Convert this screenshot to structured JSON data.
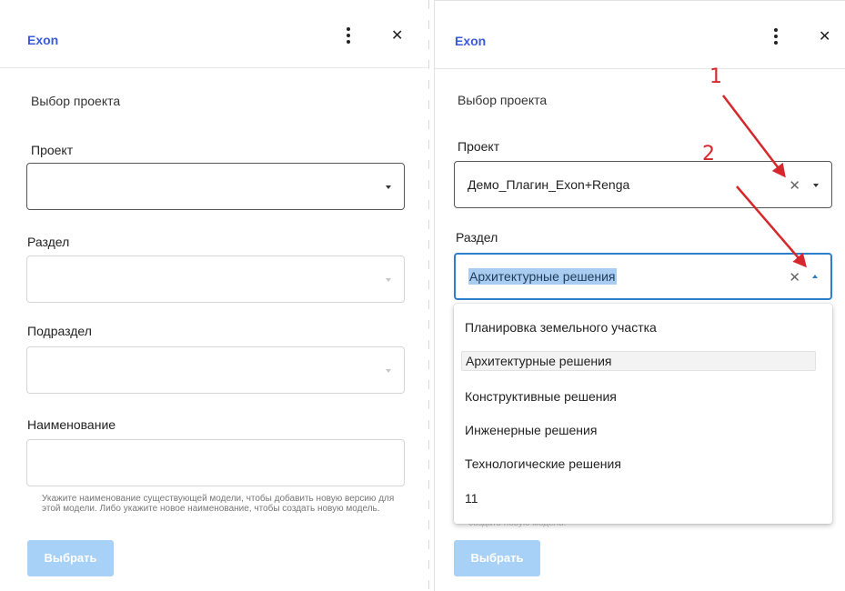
{
  "left": {
    "brand": "Exon",
    "section_title": "Выбор проекта",
    "project_label": "Проект",
    "section_label": "Раздел",
    "subsection_label": "Подраздел",
    "name_label": "Наименование",
    "helper": "Укажите наименование существующей модели, чтобы добавить новую версию для этой модели. Либо укажите новое наименование, чтобы создать новую модель.",
    "button": "Выбрать"
  },
  "right": {
    "brand": "Exon",
    "section_title": "Выбор проекта",
    "project_label": "Проект",
    "project_value": "Демо_Плагин_Exon+Renga",
    "section_label": "Раздел",
    "section_value": "Архитектурные решения",
    "helper_tail": "создать новую модель.",
    "button": "Выбрать"
  },
  "dropdown": {
    "options": [
      "Планировка земельного участка",
      "Архитектурные решения",
      "Конструктивные решения",
      "Инженерные решения",
      "Технологические решения",
      "11"
    ],
    "selected_index": 1
  },
  "annotations": [
    "1",
    "2"
  ],
  "colors": {
    "accent": "#2d7fcc",
    "brand": "#3b5bdb",
    "button_disabled": "#a8d1f7",
    "annotation": "#d6282c"
  }
}
